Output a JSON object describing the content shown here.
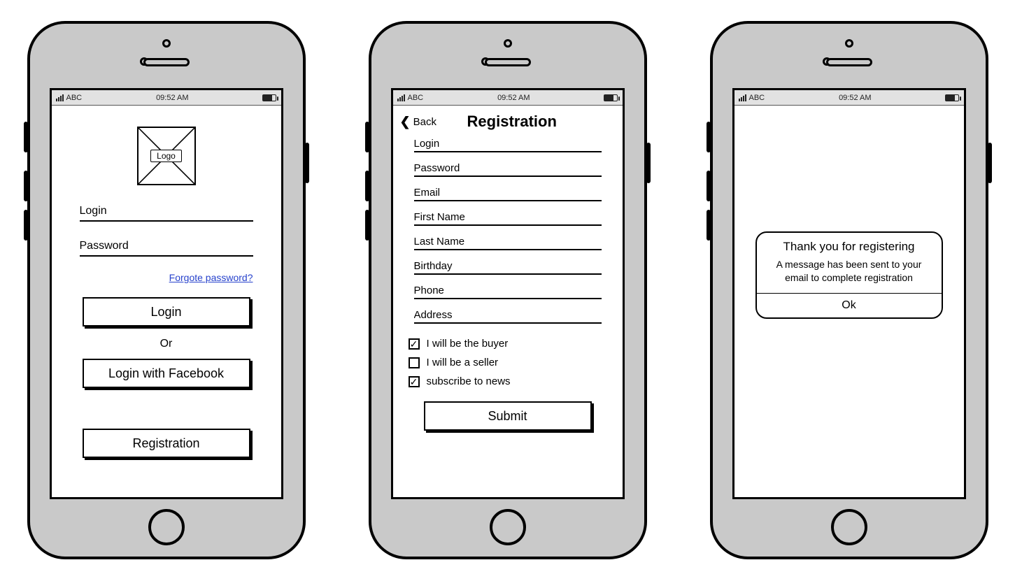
{
  "status_bar": {
    "carrier": "ABC",
    "time": "09:52 AM"
  },
  "login_screen": {
    "logo_label": "Logo",
    "login_placeholder": "Login",
    "password_placeholder": "Password",
    "forgot_link": "Forgote password?",
    "login_button": "Login",
    "or_text": "Or",
    "facebook_button": "Login with Facebook",
    "registration_button": "Registration"
  },
  "registration_screen": {
    "back_label": "Back",
    "title": "Registration",
    "fields": {
      "login": "Login",
      "password": "Password",
      "email": "Email",
      "first_name": "First Name",
      "last_name": "Last Name",
      "birthday": "Birthday",
      "phone": "Phone",
      "address": "Address"
    },
    "checkboxes": {
      "buyer": {
        "label": "I will be the buyer",
        "checked": true
      },
      "seller": {
        "label": "I will be a seller",
        "checked": false
      },
      "news": {
        "label": "subscribe to news",
        "checked": true
      }
    },
    "submit_button": "Submit"
  },
  "confirmation_screen": {
    "title": "Thank you for registering",
    "message": "A message has been sent to your email to complete registration",
    "ok_button": "Ok"
  }
}
